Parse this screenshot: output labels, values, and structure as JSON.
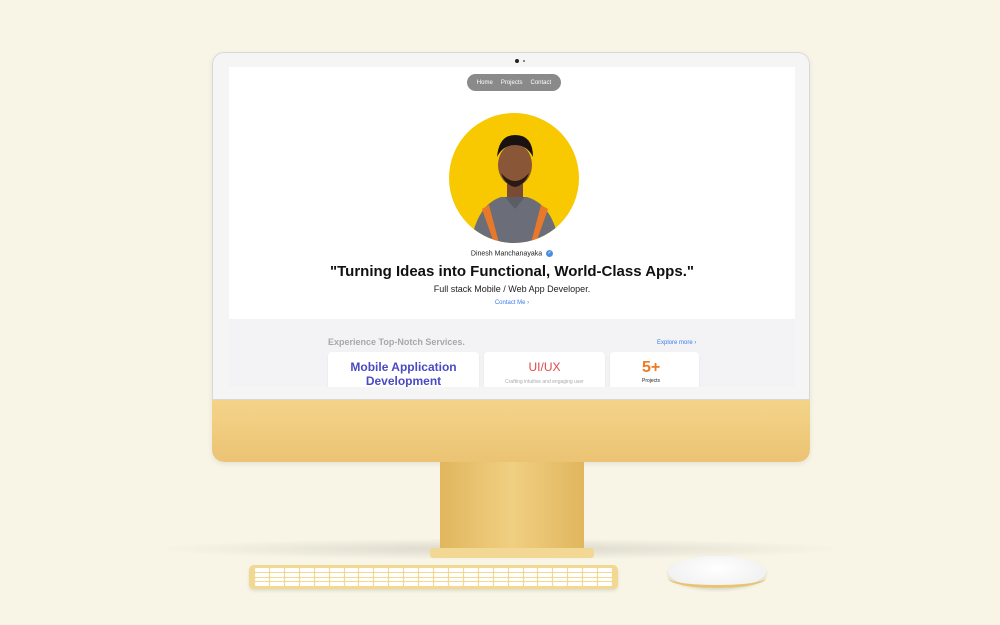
{
  "nav": {
    "items": [
      "Home",
      "Projects",
      "Contact"
    ]
  },
  "profile": {
    "name": "Dinesh Manchanayaka",
    "verified_icon": "verified-badge-icon",
    "headline": "\"Turning Ideas into Functional, World-Class Apps.\"",
    "subtitle": "Full stack Mobile / Web App Developer.",
    "contact_link": "Contact Me"
  },
  "services": {
    "title": "Experience Top-Notch Services.",
    "explore_link": "Explore more",
    "cards": [
      {
        "title": "Mobile Application Development"
      },
      {
        "title": "UI/UX",
        "desc": "Crafting intuitive and engaging user"
      },
      {
        "title": "5+",
        "label": "Projects"
      }
    ]
  },
  "colors": {
    "accent_blue": "#3b7bf0",
    "avatar_bg": "#f8c800",
    "mobile_title": "#4a4ac2",
    "uiux_title": "#e04848",
    "projects_count": "#f07a20"
  }
}
